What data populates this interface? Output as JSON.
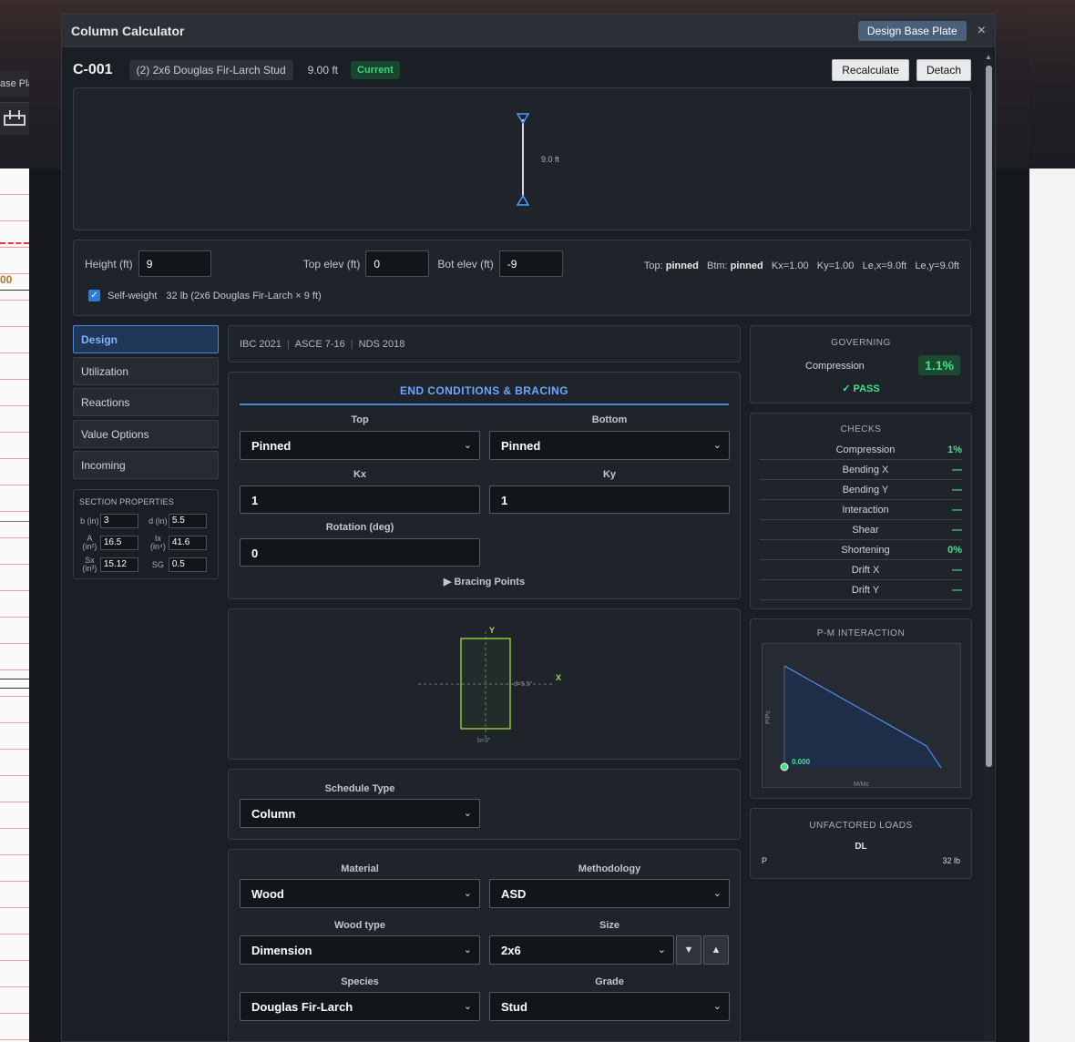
{
  "background": {
    "tab_label": "ase Pla",
    "mark_label": "00"
  },
  "modal": {
    "title": "Column Calculator",
    "design_base_plate": "Design Base Plate",
    "close": "×"
  },
  "header": {
    "column_id": "C-001",
    "description": "(2) 2x6 Douglas Fir-Larch Stud",
    "height": "9.00 ft",
    "status": "Current",
    "recalculate": "Recalculate",
    "detach": "Detach"
  },
  "elevation": {
    "length_label": "9.0 ft"
  },
  "properties": {
    "height_label": "Height (ft)",
    "height_value": "9",
    "top_elev_label": "Top elev (ft)",
    "top_elev_value": "0",
    "bot_elev_label": "Bot elev (ft)",
    "bot_elev_value": "-9",
    "summary_top_label": "Top:",
    "summary_top": "pinned",
    "summary_btm_label": "Btm:",
    "summary_btm": "pinned",
    "summary_rest": "Kx=1.00   Ky=1.00   Le,x=9.0ft   Le,y=9.0ft",
    "self_weight_label": "Self-weight",
    "self_weight_value": "32 lb (2x6 Douglas Fir-Larch × 9 ft)",
    "self_weight_checked": true
  },
  "nav": {
    "items": [
      {
        "label": "Design",
        "active": true
      },
      {
        "label": "Utilization"
      },
      {
        "label": "Reactions"
      },
      {
        "label": "Value Options"
      },
      {
        "label": "Incoming"
      }
    ]
  },
  "section_properties": {
    "title": "SECTION PROPERTIES",
    "b_label": "b (in)",
    "b": "3",
    "d_label": "d (in)",
    "d": "5.5",
    "A_label": "A (in²)",
    "A": "16.5",
    "Ix_label": "Ix (in⁴)",
    "Ix": "41.6",
    "Sx_label": "Sx (in³)",
    "Sx": "15.12",
    "SG_label": "SG",
    "SG": "0.5"
  },
  "codes": {
    "ibc": "IBC 2021",
    "asce": "ASCE 7-16",
    "nds": "NDS 2018"
  },
  "end_conditions": {
    "title": "END CONDITIONS & BRACING",
    "top_label": "Top",
    "top_value": "Pinned",
    "bottom_label": "Bottom",
    "bottom_value": "Pinned",
    "kx_label": "Kx",
    "kx_value": "1",
    "ky_label": "Ky",
    "ky_value": "1",
    "rotation_label": "Rotation (deg)",
    "rotation_value": "0",
    "bracing_points": "▶ Bracing Points"
  },
  "section_view": {
    "y_axis": "Y",
    "x_axis": "X",
    "d_label": "d=5.5\"",
    "b_label": "b=3\""
  },
  "schedule": {
    "label": "Schedule Type",
    "value": "Column"
  },
  "material": {
    "material_label": "Material",
    "material_value": "Wood",
    "method_label": "Methodology",
    "method_value": "ASD",
    "wood_type_label": "Wood type",
    "wood_type_value": "Dimension",
    "size_label": "Size",
    "size_value": "2x6",
    "species_label": "Species",
    "species_value": "Douglas Fir-Larch",
    "grade_label": "Grade",
    "grade_value": "Stud"
  },
  "governing": {
    "title": "GOVERNING",
    "label": "Compression",
    "value": "1.1%",
    "result": "✓ PASS"
  },
  "checks": {
    "title": "CHECKS",
    "rows": [
      {
        "name": "Compression",
        "value": "1%"
      },
      {
        "name": "Bending X",
        "value": "—"
      },
      {
        "name": "Bending Y",
        "value": "—"
      },
      {
        "name": "Interaction",
        "value": "—"
      },
      {
        "name": "Shear",
        "value": "—"
      },
      {
        "name": "Shortening",
        "value": "0%"
      },
      {
        "name": "Drift X",
        "value": "—"
      },
      {
        "name": "Drift Y",
        "value": "—"
      }
    ]
  },
  "pm_interaction": {
    "title": "P-M INTERACTION",
    "y_label": "P/Pc",
    "x_label": "M/Mc",
    "point_label": "0.000"
  },
  "unfactored": {
    "title": "UNFACTORED LOADS",
    "column": "DL",
    "row_label": "P",
    "row_value": "32 lb"
  },
  "colors": {
    "accent": "#4c86d6",
    "pass": "#46e08a",
    "section_outline": "#8fc43a"
  }
}
